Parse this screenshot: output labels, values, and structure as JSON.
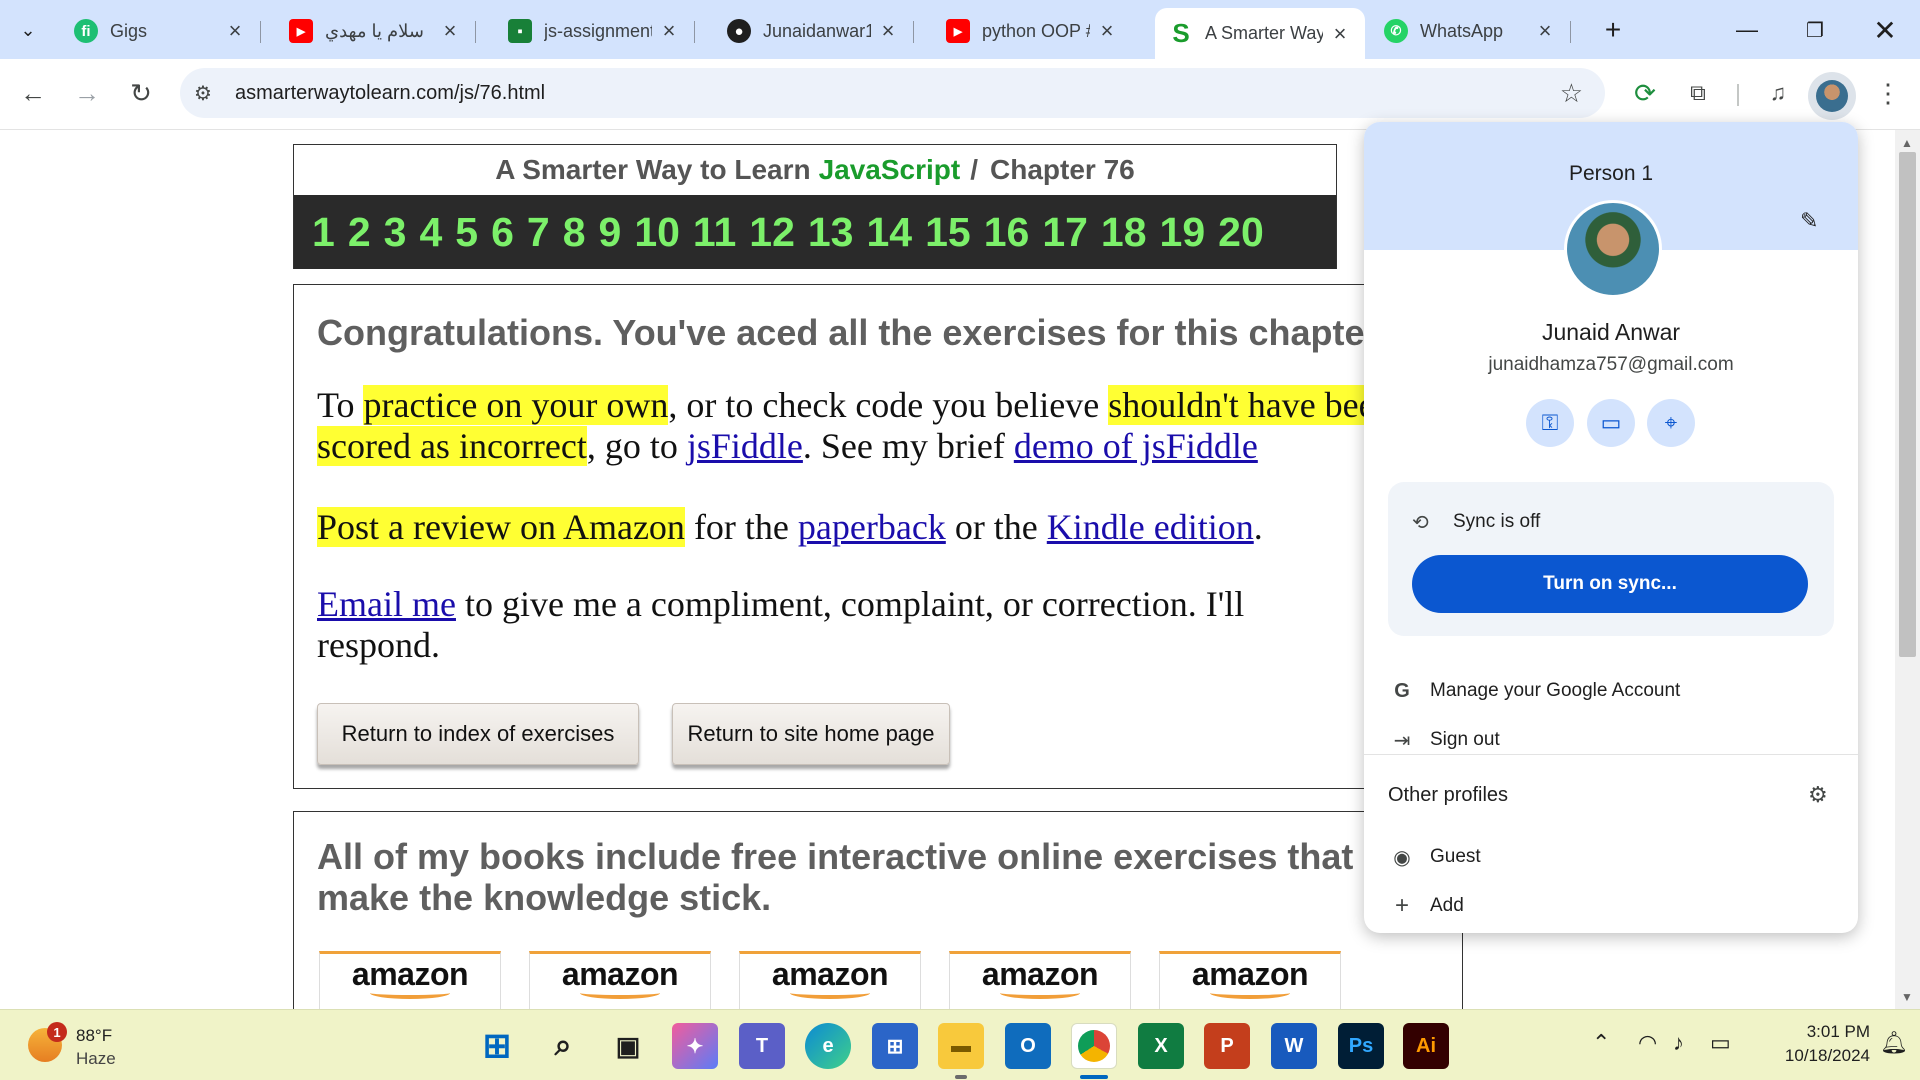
{
  "browser": {
    "tabs": [
      {
        "title": "Gigs",
        "icon": "fiverr-icon",
        "icon_text": "fi",
        "color": "#1dbf73"
      },
      {
        "title": "سلام يا مهدي",
        "icon": "youtube-icon",
        "icon_text": "▶",
        "color": "#ff0000"
      },
      {
        "title": "js-assignment",
        "icon": "classroom-icon",
        "icon_text": "■",
        "color": "#188038"
      },
      {
        "title": "Junaidanwar1/",
        "icon": "github-icon",
        "icon_text": "●",
        "color": "#1f1f1f"
      },
      {
        "title": "python OOP #",
        "icon": "youtube-icon",
        "icon_text": "▶",
        "color": "#ff0000"
      },
      {
        "title": "A Smarter Way",
        "icon": "smarterway-icon",
        "icon_text": "S",
        "color": "#1a9c2c",
        "active": true
      },
      {
        "title": "WhatsApp",
        "icon": "whatsapp-icon",
        "icon_text": "✆",
        "color": "#25d366"
      }
    ],
    "new_tab_label": "+",
    "url": "asmarterwaytolearn.com/js/76.html"
  },
  "page": {
    "header": {
      "prefix": "A Smarter Way to Learn",
      "js": "JavaScript",
      "separator": "/",
      "chapter": "Chapter 76"
    },
    "chapter_numbers": [
      "1",
      "2",
      "3",
      "4",
      "5",
      "6",
      "7",
      "8",
      "9",
      "10",
      "11",
      "12",
      "13",
      "14",
      "15",
      "16",
      "17",
      "18",
      "19",
      "20"
    ],
    "congrats": "Congratulations. You've aced all the exercises for this chapter.",
    "practice": {
      "p1": "To ",
      "h1": "practice on your own",
      "p2": ", or to check code you believe ",
      "h2": "shouldn't have been scored as incorrect",
      "p3": ", go to ",
      "link1": "jsFiddle",
      "p4": ". See my brief ",
      "link2": "demo of jsFiddle"
    },
    "review": {
      "h": "Post a review on Amazon",
      "p1": " for the ",
      "link1": "paperback",
      "p2": " or the ",
      "link2": "Kindle edition",
      "p3": "."
    },
    "email": {
      "link": "Email me",
      "text": " to give me a compliment, complaint, or correction. I'll respond."
    },
    "buttons": {
      "index": "Return to index of exercises",
      "home": "Return to site home page"
    },
    "books_text": "All of my books include free interactive online exercises that make the knowledge stick.",
    "amazon_label": "amazon"
  },
  "profile": {
    "header": "Person 1",
    "name": "Junaid Anwar",
    "email": "junaidhamza757@gmail.com",
    "sync_status": "Sync is off",
    "sync_button": "Turn on sync...",
    "manage": "Manage your Google Account",
    "signout": "Sign out",
    "other_profiles": "Other profiles",
    "guest": "Guest",
    "add": "Add"
  },
  "taskbar": {
    "weather_temp": "88°F",
    "weather_cond": "Haze",
    "weather_badge": "1",
    "time": "3:01 PM",
    "date": "10/18/2024"
  }
}
